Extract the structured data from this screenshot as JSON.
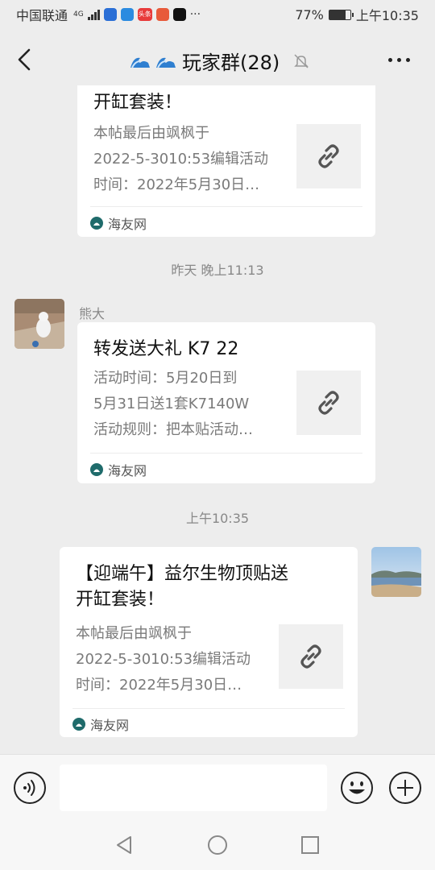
{
  "status": {
    "carrier": "中国联通",
    "network": "4G",
    "app_icons": [
      "shield-app-icon",
      "bulb-app-icon",
      "toutiao-app-icon",
      "news-app-icon",
      "tiktok-app-icon"
    ],
    "app_icon_labels": [
      "头条"
    ],
    "more": "···",
    "battery": "77%",
    "battery_level": 0.77,
    "time": "上午10:35"
  },
  "header": {
    "title": "玩家群(28)",
    "muted": true
  },
  "messages": [
    {
      "type": "link_card",
      "side": "left",
      "title": "开缸套装！",
      "desc": [
        "本帖最后由飒枫于",
        "2022-5-3010:53编辑活动",
        "时间：2022年5月30日…"
      ],
      "source": "海友网"
    },
    {
      "type": "time",
      "text": "昨天 晚上11:13"
    },
    {
      "type": "link_card",
      "side": "left",
      "sender": "熊大",
      "title": "转发送大礼 K7 22",
      "desc": [
        "活动时间：5月20日到",
        "5月31日送1套K7140W",
        "活动规则：把本贴活动…"
      ],
      "source": "海友网"
    },
    {
      "type": "time",
      "text": "上午10:35"
    },
    {
      "type": "link_card",
      "side": "right",
      "title": "【迎端午】益尔生物顶贴送开缸套装！",
      "title_lines": [
        "【迎端午】益尔生物顶贴送",
        "开缸套装！"
      ],
      "desc": [
        "本帖最后由飒枫于",
        "2022-5-3010:53编辑活动",
        "时间：2022年5月30日…"
      ],
      "source": "海友网"
    }
  ],
  "colors": {
    "background": "#ededed",
    "card": "#ffffff",
    "secondary_text": "#7a7a7a",
    "source_icon": "#1f6b6b"
  }
}
